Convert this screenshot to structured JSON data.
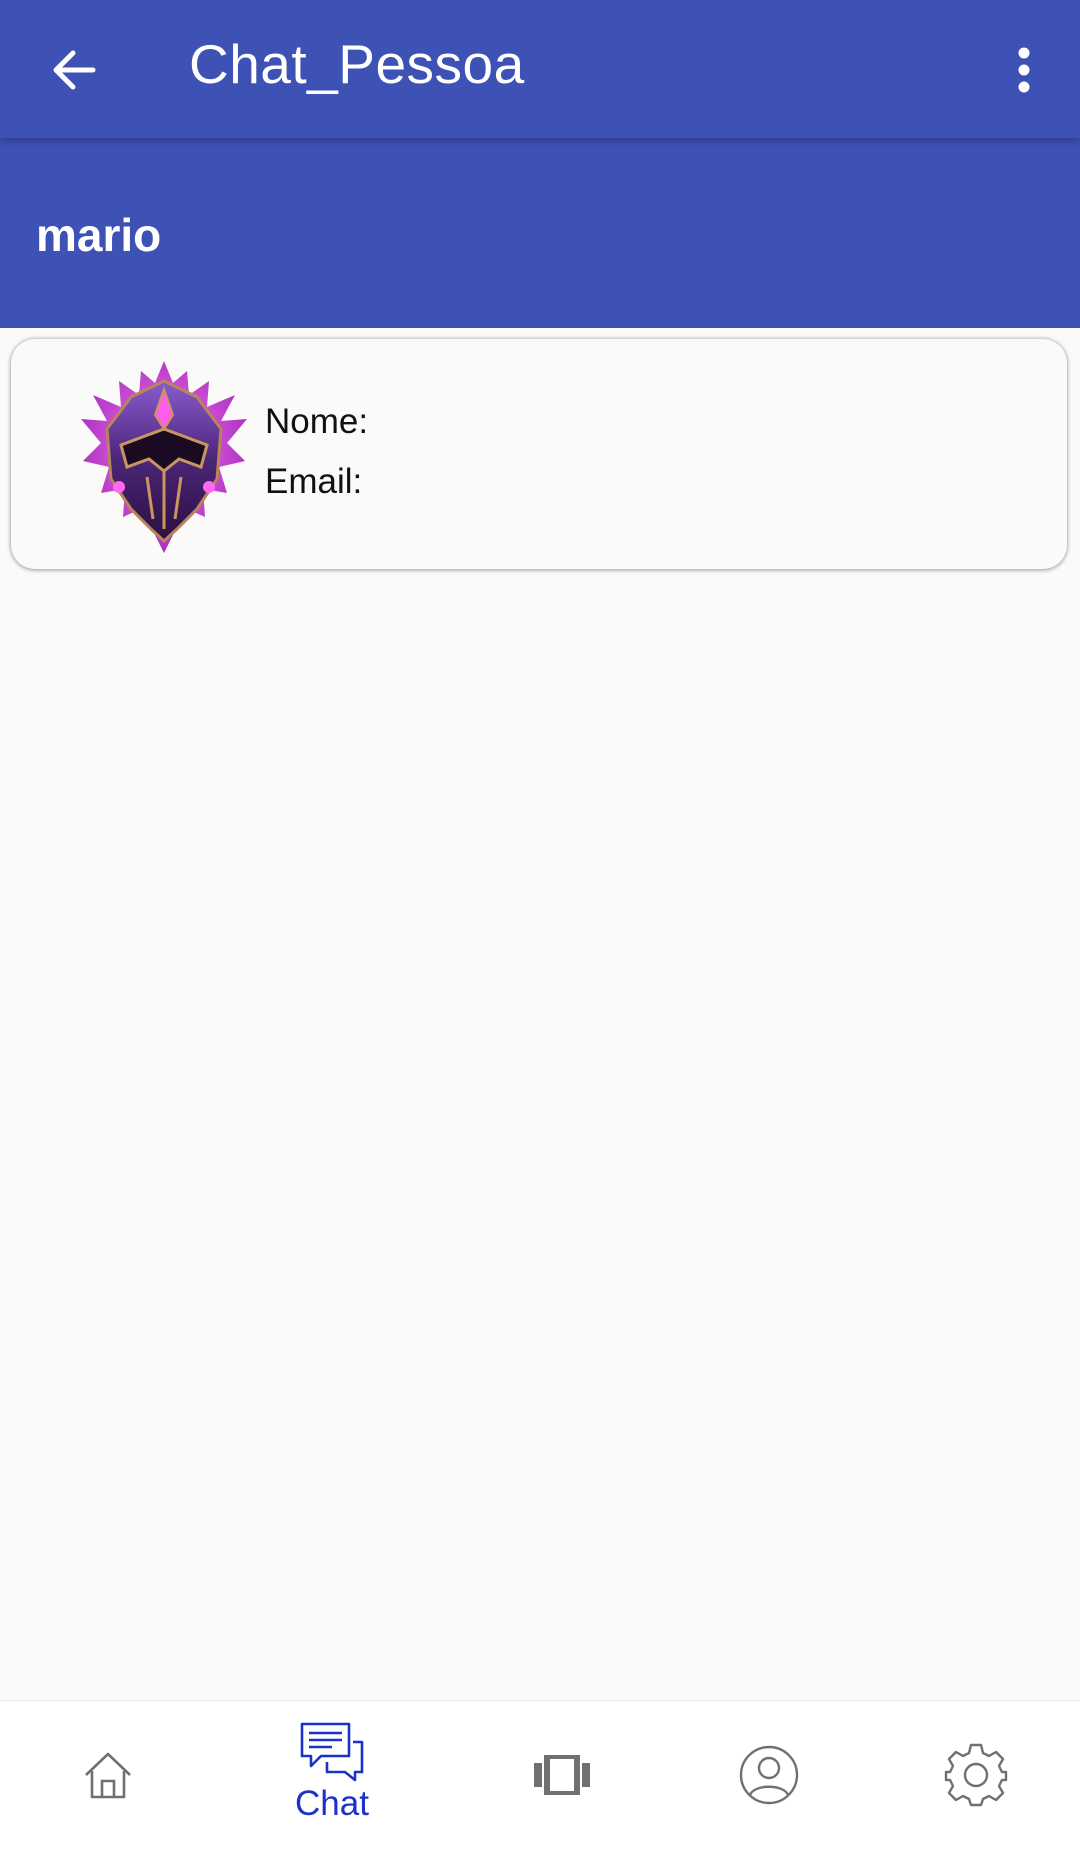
{
  "appbar": {
    "title": "Chat_Pessoa",
    "back_icon": "arrow-left-icon",
    "menu_icon": "more-vertical-icon"
  },
  "user_header": {
    "name": "mario"
  },
  "profile_card": {
    "avatar_icon": "purple-crest-avatar",
    "name_label": "Nome:",
    "email_label": "Email:"
  },
  "bottom_nav": {
    "items": [
      {
        "icon": "home-icon",
        "label": ""
      },
      {
        "icon": "chat-icon",
        "label": "Chat",
        "active": true
      },
      {
        "icon": "carousel-icon",
        "label": ""
      },
      {
        "icon": "profile-icon",
        "label": ""
      },
      {
        "icon": "settings-icon",
        "label": ""
      }
    ]
  },
  "colors": {
    "primary": "#3e51b5",
    "active_nav": "#1b32c8",
    "background": "#fafaf8"
  }
}
